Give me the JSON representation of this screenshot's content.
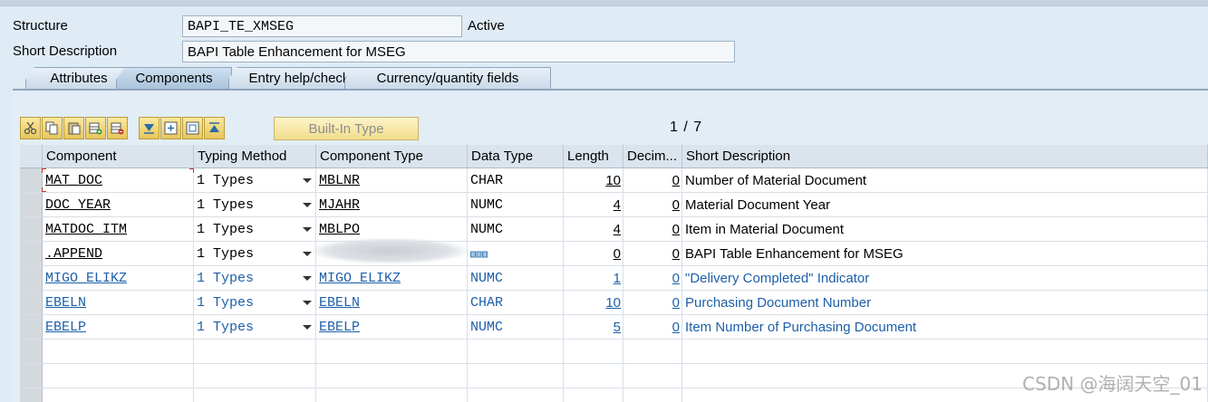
{
  "header": {
    "structure_label": "Structure",
    "structure_value": "BAPI_TE_XMSEG",
    "status": "Active",
    "short_desc_label": "Short Description",
    "short_desc_value": "BAPI Table Enhancement for MSEG"
  },
  "tabs": [
    {
      "label": "Attributes",
      "active": false
    },
    {
      "label": "Components",
      "active": true
    },
    {
      "label": "Entry help/check",
      "active": false
    },
    {
      "label": "Currency/quantity fields",
      "active": false
    }
  ],
  "toolbar": {
    "icons": [
      "cut-icon",
      "copy-icon",
      "paste-icon",
      "insert-row-icon",
      "delete-row-icon",
      "move-down-icon",
      "expand-icon",
      "collapse-icon",
      "move-up-icon"
    ],
    "builtin_type_label": "Built-In Type",
    "pager": "1 / 7"
  },
  "columns": [
    "Component",
    "Typing Method",
    "Component Type",
    "Data Type",
    "Length",
    "Decim...",
    "Short Description"
  ],
  "rows": [
    {
      "component": "MAT_DOC",
      "typing": "1 Types",
      "comp_type": "MBLNR",
      "data_type": "CHAR",
      "length": "10",
      "decimals": "0",
      "desc": "Number of Material Document",
      "included": false
    },
    {
      "component": "DOC_YEAR",
      "typing": "1 Types",
      "comp_type": "MJAHR",
      "data_type": "NUMC",
      "length": "4",
      "decimals": "0",
      "desc": "Material Document Year",
      "included": false
    },
    {
      "component": "MATDOC_ITM",
      "typing": "1 Types",
      "comp_type": "MBLPO",
      "data_type": "NUMC",
      "length": "4",
      "decimals": "0",
      "desc": "Item in Material Document",
      "included": false
    },
    {
      "component": ".APPEND",
      "typing": "1 Types",
      "comp_type": "",
      "data_type": "",
      "length": "0",
      "decimals": "0",
      "desc": "BAPI Table Enhancement for MSEG",
      "included": false
    },
    {
      "component": "MIGO_ELIKZ",
      "typing": "1 Types",
      "comp_type": "MIGO_ELIKZ",
      "data_type": "NUMC",
      "length": "1",
      "decimals": "0",
      "desc": "\"Delivery Completed\" Indicator",
      "included": true
    },
    {
      "component": "EBELN",
      "typing": "1 Types",
      "comp_type": "EBELN",
      "data_type": "CHAR",
      "length": "10",
      "decimals": "0",
      "desc": "Purchasing Document Number",
      "included": true
    },
    {
      "component": "EBELP",
      "typing": "1 Types",
      "comp_type": "EBELP",
      "data_type": "NUMC",
      "length": "5",
      "decimals": "0",
      "desc": "Item Number of Purchasing Document",
      "included": true
    }
  ],
  "watermark": "CSDN @海阔天空_01",
  "colors": {
    "included_text": "#1d5fa8",
    "toolbar_button": "#e8c65a",
    "background": "#dfebf5"
  }
}
